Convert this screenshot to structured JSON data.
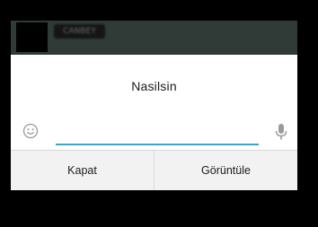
{
  "header": {
    "contact_name": "CANBEY"
  },
  "message": {
    "text": "Nasilsin"
  },
  "reply": {
    "value": "",
    "placeholder": ""
  },
  "icons": {
    "emoji": "smiley-face-icon",
    "microphone": "microphone-icon"
  },
  "actions": {
    "close_label": "Kapat",
    "view_label": "Görüntüle"
  },
  "colors": {
    "header_background": "#303a36",
    "input_underline": "#3ea3c8",
    "dialog_background": "#ffffff",
    "actions_background": "#f2f2f2"
  }
}
